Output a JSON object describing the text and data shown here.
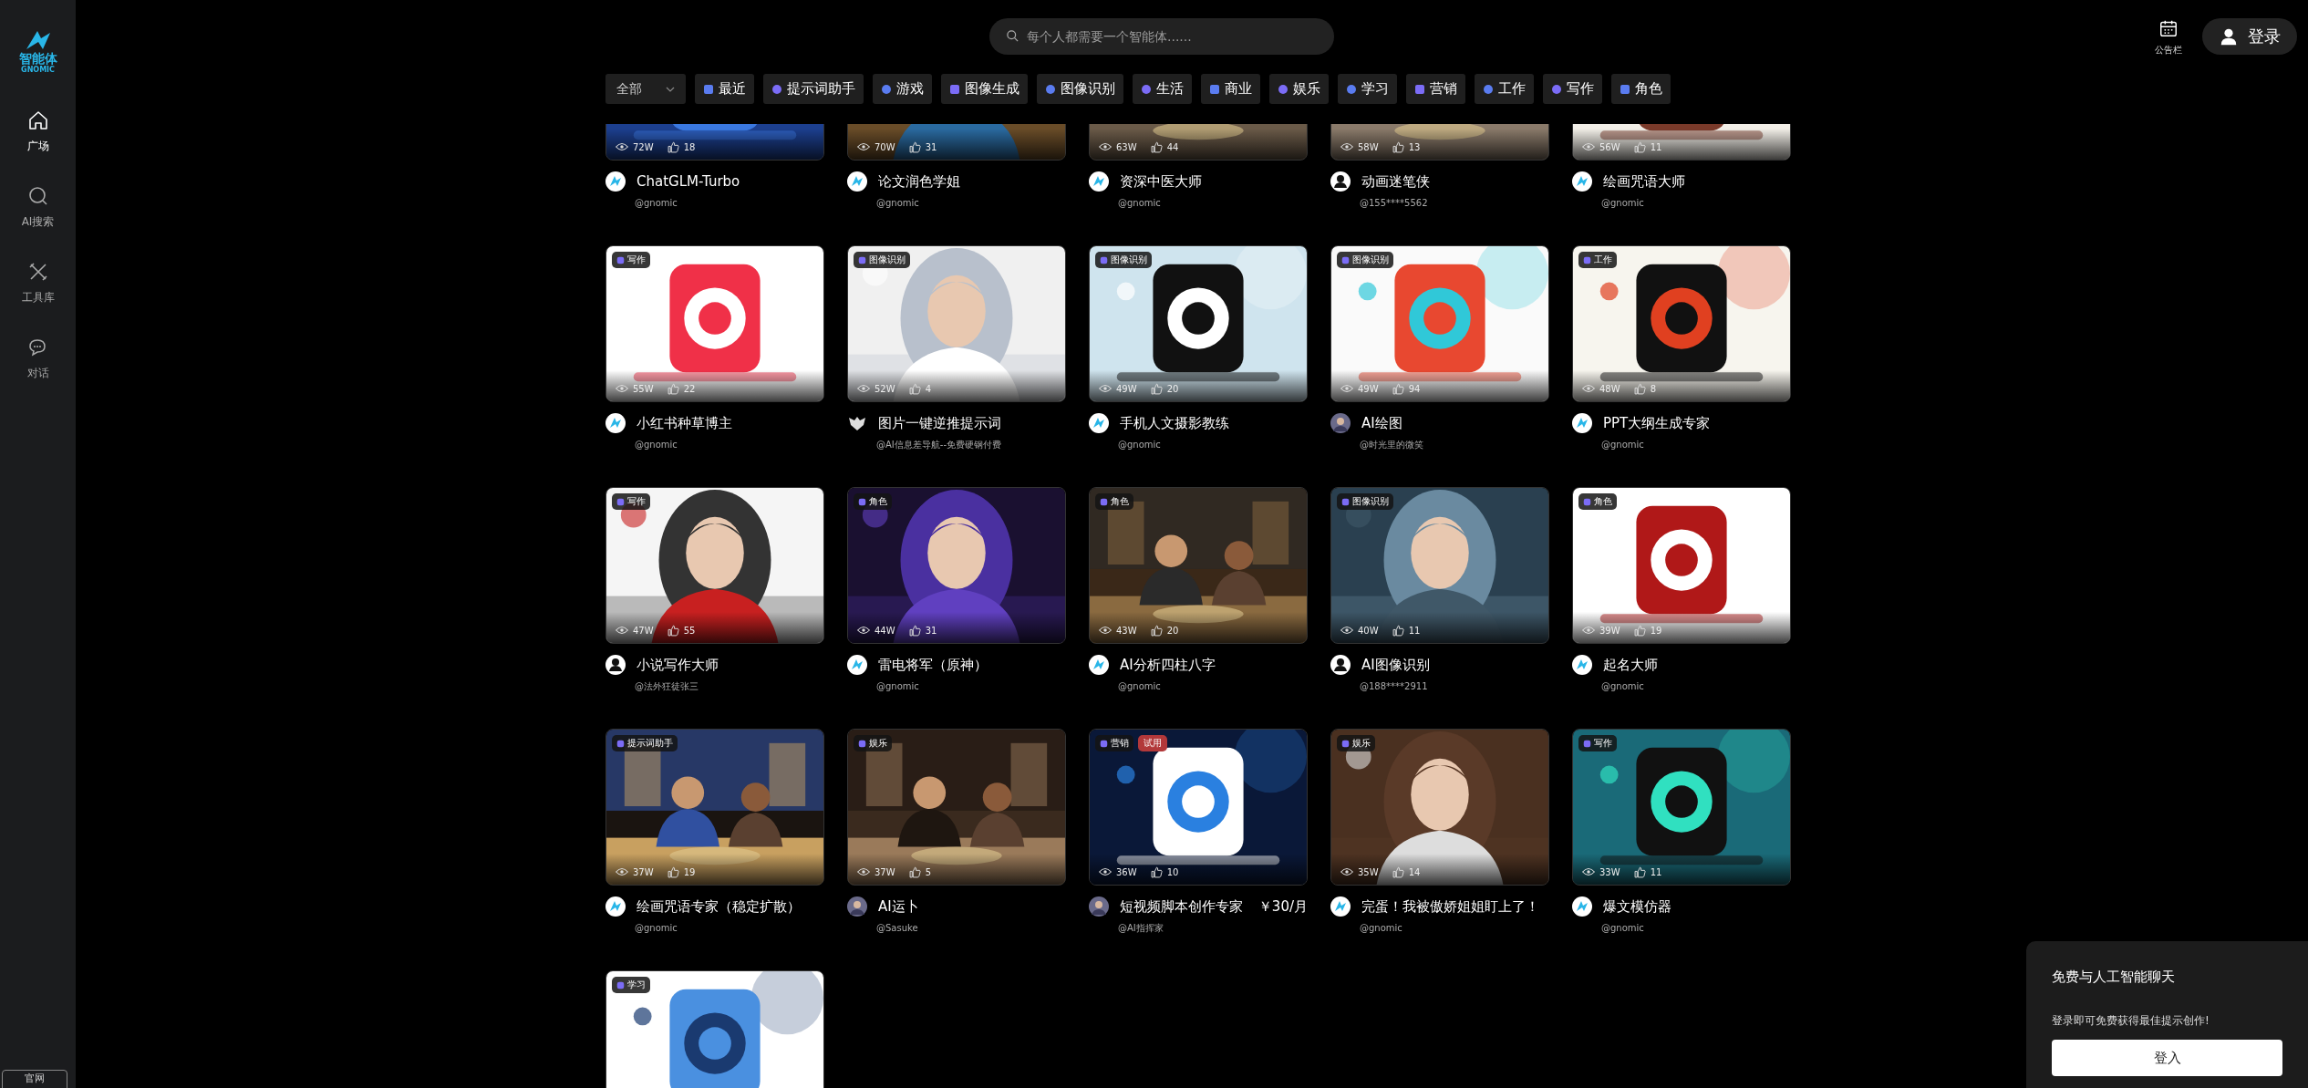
{
  "sidebar": {
    "logo": {
      "name": "智能体",
      "subtitle": "GNOMIC"
    },
    "items": [
      {
        "label": "广场",
        "selected": true
      },
      {
        "label": "AI搜索",
        "selected": false
      },
      {
        "label": "工具库",
        "selected": false
      },
      {
        "label": "对话",
        "selected": false
      }
    ],
    "footer_button": "官网"
  },
  "header": {
    "search": {
      "placeholder": "每个人都需要一个智能体......"
    },
    "notice_label": "公告栏",
    "login_button": "登录"
  },
  "category_filter": {
    "dropdown": "全部",
    "tabs": [
      {
        "label": "最近"
      },
      {
        "label": "提示词助手"
      },
      {
        "label": "游戏"
      },
      {
        "label": "图像生成"
      },
      {
        "label": "图像识别"
      },
      {
        "label": "生活"
      },
      {
        "label": "商业"
      },
      {
        "label": "娱乐"
      },
      {
        "label": "学习"
      },
      {
        "label": "营销"
      },
      {
        "label": "工作"
      },
      {
        "label": "写作"
      },
      {
        "label": "角色"
      }
    ]
  },
  "cards": [
    {
      "title": "ChatGLM-Turbo",
      "author": "@gnomic",
      "views": "72W",
      "likes": "18",
      "avatar": {
        "kind": "logo"
      }
    },
    {
      "title": "论文润色学姐",
      "author": "@gnomic",
      "views": "70W",
      "likes": "31",
      "avatar": {
        "kind": "logo"
      }
    },
    {
      "title": "资深中医大师",
      "author": "@gnomic",
      "views": "63W",
      "likes": "44",
      "avatar": {
        "kind": "logo"
      }
    },
    {
      "title": "动画迷笔侠",
      "author": "@155****5562",
      "views": "58W",
      "likes": "13",
      "avatar": {
        "kind": "user"
      }
    },
    {
      "title": "绘画咒语大师",
      "author": "@gnomic",
      "views": "56W",
      "likes": "11",
      "avatar": {
        "kind": "logo"
      }
    },
    {
      "category": "写作",
      "title": "小红书种草博主",
      "author": "@gnomic",
      "views": "55W",
      "likes": "22",
      "avatar": {
        "kind": "logo"
      }
    },
    {
      "category": "图像识别",
      "title": "图片一键逆推提示词",
      "author": "@AI信息差导航--免费硬钢付费",
      "views": "52W",
      "likes": "4",
      "avatar": {
        "kind": "mask"
      }
    },
    {
      "category": "图像识别",
      "title": "手机人文摄影教练",
      "author": "@gnomic",
      "views": "49W",
      "likes": "20",
      "avatar": {
        "kind": "logo"
      }
    },
    {
      "category": "图像识别",
      "title": "AI绘图",
      "author": "@时光里的微笑",
      "views": "49W",
      "likes": "94"
    },
    {
      "category": "工作",
      "title": "PPT大纲生成专家",
      "author": "@gnomic",
      "views": "48W",
      "likes": "8",
      "avatar": {
        "kind": "logo"
      }
    },
    {
      "category": "写作",
      "title": "小说写作大师",
      "author": "@法外狂徒张三",
      "views": "47W",
      "likes": "55",
      "avatar": {
        "kind": "user"
      }
    },
    {
      "category": "角色",
      "title": "雷电将军（原神）",
      "author": "@gnomic",
      "views": "44W",
      "likes": "31",
      "avatar": {
        "kind": "logo"
      }
    },
    {
      "category": "角色",
      "title": "AI分析四柱八字",
      "author": "@gnomic",
      "views": "43W",
      "likes": "20",
      "avatar": {
        "kind": "logo"
      }
    },
    {
      "category": "图像识别",
      "title": "AI图像识别",
      "author": "@188****2911",
      "views": "40W",
      "likes": "11",
      "avatar": {
        "kind": "user"
      }
    },
    {
      "category": "角色",
      "title": "起名大师",
      "author": "@gnomic",
      "views": "39W",
      "likes": "19",
      "avatar": {
        "kind": "logo"
      }
    },
    {
      "category": "提示词助手",
      "title": "绘画咒语专家（稳定扩散）",
      "author": "@gnomic",
      "views": "37W",
      "likes": "19",
      "avatar": {
        "kind": "logo"
      }
    },
    {
      "category": "娱乐",
      "title": "AI运卜",
      "author": "@Sasuke",
      "views": "37W",
      "likes": "5"
    },
    {
      "category": "营销",
      "trial": "试用",
      "title": "短视频脚本创作专家",
      "price": "￥30/月",
      "author": "@AI指挥家",
      "views": "36W",
      "likes": "10"
    },
    {
      "category": "娱乐",
      "title": "完蛋！我被傲娇姐姐盯上了！",
      "author": "@gnomic",
      "views": "35W",
      "likes": "14",
      "avatar": {
        "kind": "logo"
      }
    },
    {
      "category": "写作",
      "title": "爆文模仿器",
      "author": "@gnomic",
      "views": "33W",
      "likes": "11",
      "avatar": {
        "kind": "logo"
      }
    },
    {
      "category": "学习"
    }
  ],
  "login_prompt": {
    "title": "免费与人工智能聊天",
    "text": "登录即可免费获得最佳提示创作!",
    "button": "登入"
  }
}
